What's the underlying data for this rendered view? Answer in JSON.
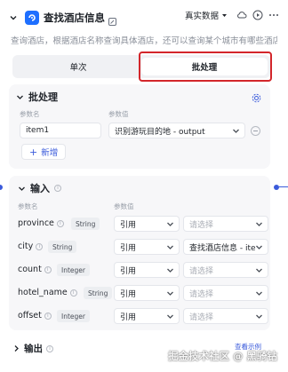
{
  "header": {
    "title": "查找酒店信息",
    "mode": "真实数据",
    "description": "查询酒店，根据酒店名称查询具体酒店，还可以查询某个城市有哪些酒店"
  },
  "tabs": [
    {
      "label": "单次",
      "active": false
    },
    {
      "label": "批处理",
      "active": true
    }
  ],
  "batch": {
    "title": "批处理",
    "col_name": "参数名",
    "col_value": "参数值",
    "item_name": "item1",
    "item_value": "识别游玩目的地 - output",
    "add_label": "新增"
  },
  "input": {
    "title": "输入",
    "col_name": "参数名",
    "col_value": "参数值",
    "params": [
      {
        "name": "province",
        "type": "String",
        "ref": "引用",
        "value": "请选择",
        "placeholder": true
      },
      {
        "name": "city",
        "type": "String",
        "ref": "引用",
        "value": "查找酒店信息 - ite",
        "placeholder": false
      },
      {
        "name": "count",
        "type": "Integer",
        "ref": "引用",
        "value": "请选择",
        "placeholder": true
      },
      {
        "name": "hotel_name",
        "type": "String",
        "ref": "引用",
        "value": "请选择",
        "placeholder": true
      },
      {
        "name": "offset",
        "type": "Integer",
        "ref": "引用",
        "value": "请选择",
        "placeholder": true
      }
    ]
  },
  "output": {
    "title": "输出",
    "view_example": "查看示例"
  },
  "watermark": "掘金技术社区 @ 黑骑钻",
  "colors": {
    "accent": "#3b5bdb",
    "highlight": "#d3262b",
    "app_icon": "#1e6fff"
  }
}
